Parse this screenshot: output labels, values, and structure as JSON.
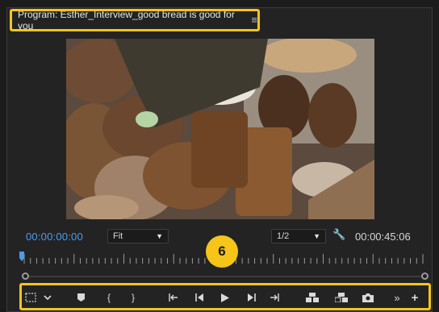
{
  "program_tab": {
    "title": "Program: Esther_Interview_good bread is good for you",
    "menu_icon": "hamburger-menu-icon"
  },
  "monitor": {
    "current_timecode": "00:00:00:00",
    "zoom": "Fit",
    "resolution": "1/2",
    "duration": "00:00:45:06",
    "playhead_position": 0,
    "in_point": 0,
    "out_point": 1
  },
  "callout": {
    "number": "6"
  },
  "toolbar": {
    "buttons": [
      "safe-margins-icon",
      "settings-chevron-icon",
      "add-marker-icon",
      "mark-in-icon",
      "mark-out-icon",
      "go-to-in-icon",
      "step-back-icon",
      "play-icon",
      "step-forward-icon",
      "go-to-out-icon",
      "lift-icon",
      "extract-icon",
      "export-frame-icon",
      "more-icon",
      "add-button-icon"
    ]
  },
  "colors": {
    "highlight": "#f5c518",
    "timecode_blue": "#4a9cf0"
  }
}
